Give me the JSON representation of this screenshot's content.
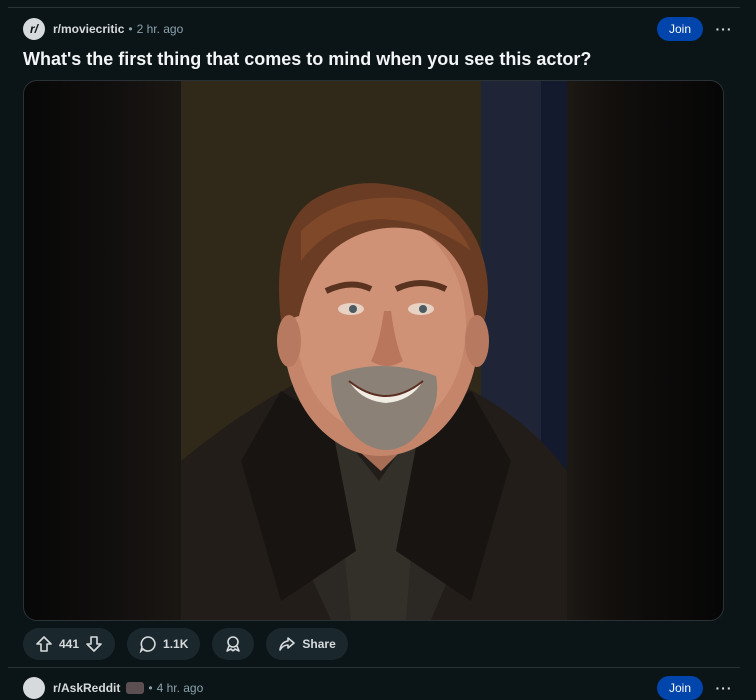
{
  "post": {
    "subreddit": "r/moviecritic",
    "avatar_glyph": "r/",
    "separator": "•",
    "time": "2 hr. ago",
    "join_label": "Join",
    "more_label": "···",
    "title": "What's the first thing that comes to mind when you see this actor?",
    "actions": {
      "upvotes": "441",
      "comments": "1.1K",
      "share_label": "Share"
    },
    "icons": {
      "upvote": "upvote-arrow-icon",
      "downvote": "downvote-arrow-icon",
      "comment": "comment-bubble-icon",
      "award": "award-icon",
      "share": "share-arrow-icon"
    }
  },
  "next_post": {
    "subreddit": "r/AskReddit",
    "time": "4 hr. ago",
    "join_label": "Join",
    "more_label": "···"
  },
  "colors": {
    "background": "#0b1416",
    "join_button": "#0045ac",
    "action_pill": "#1a282d",
    "divider": "#2a3236"
  }
}
